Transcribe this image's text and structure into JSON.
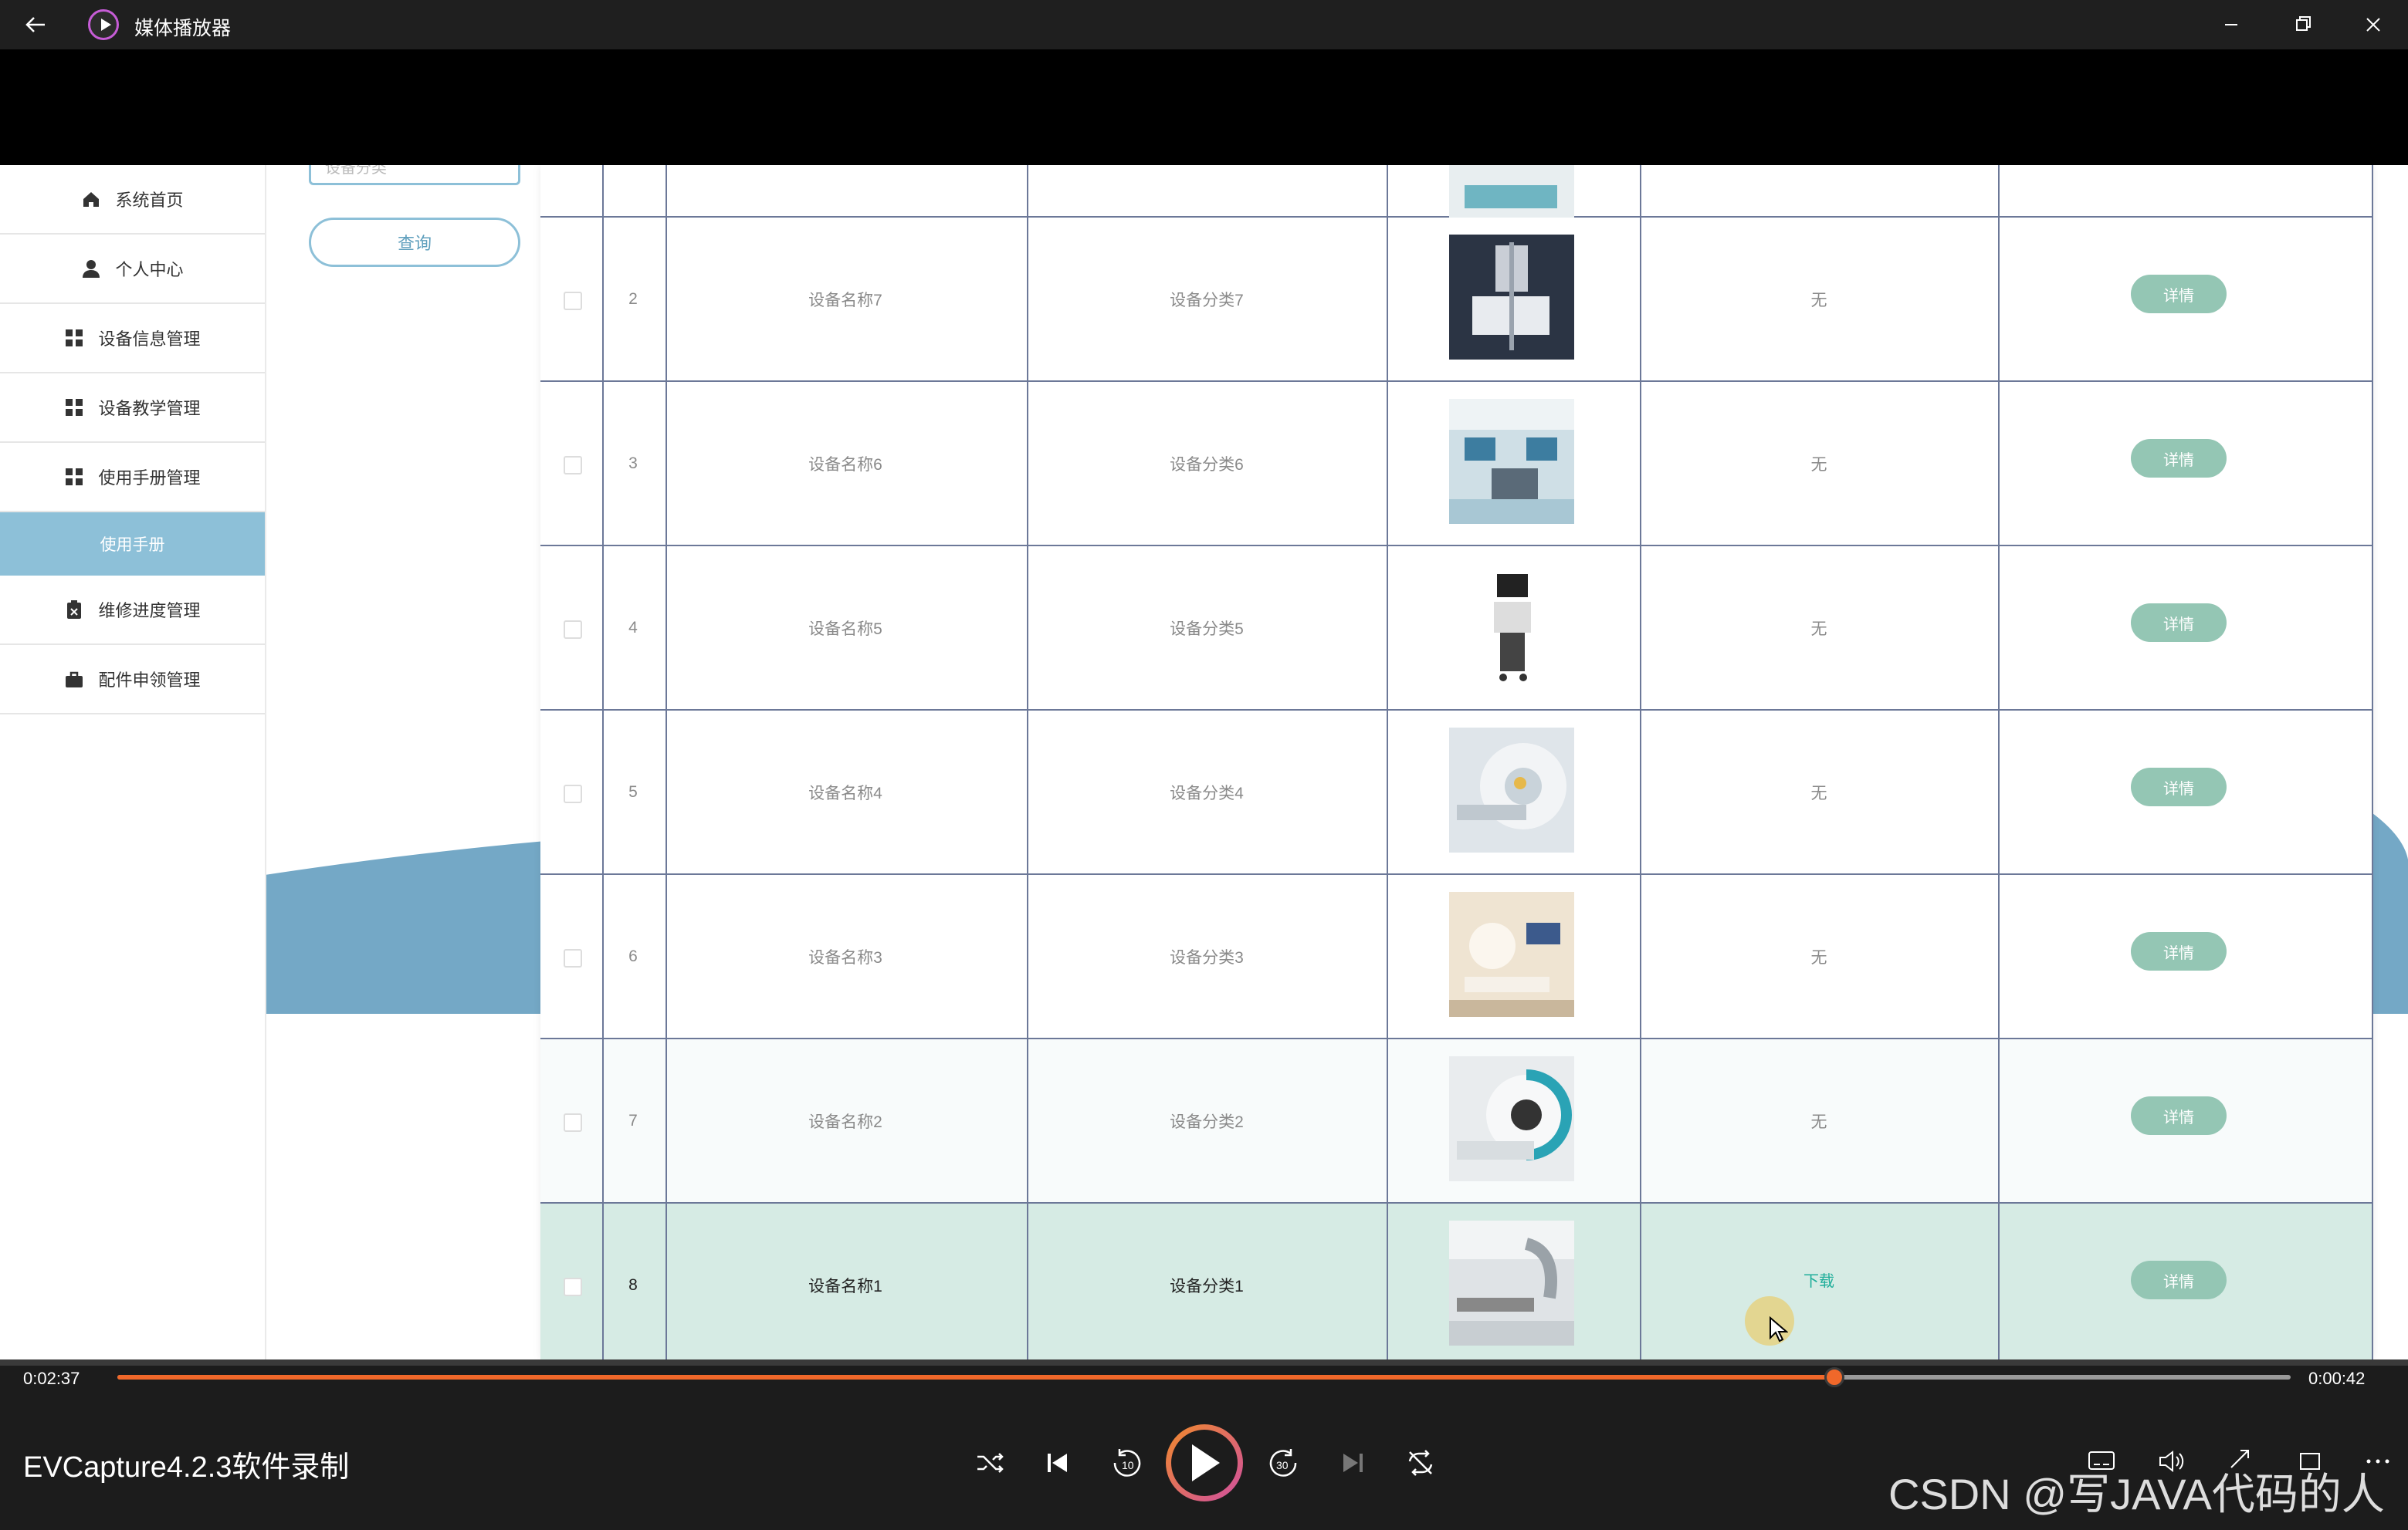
{
  "window": {
    "title": "媒体播放器"
  },
  "sidebar": {
    "items": [
      {
        "label": "系统首页",
        "icon": "home-icon"
      },
      {
        "label": "个人中心",
        "icon": "user-icon"
      },
      {
        "label": "设备信息管理",
        "icon": "grid-icon"
      },
      {
        "label": "设备教学管理",
        "icon": "grid-icon"
      },
      {
        "label": "使用手册管理",
        "icon": "grid-icon"
      },
      {
        "label": "维修进度管理",
        "icon": "clipboard-icon"
      },
      {
        "label": "配件申领管理",
        "icon": "briefcase-icon"
      }
    ],
    "active_sub": "使用手册"
  },
  "search": {
    "placeholder": "设备分类",
    "query_label": "查询"
  },
  "table": {
    "rows": [
      {
        "index": "2",
        "name": "设备名称7",
        "category": "设备分类7",
        "file": "无",
        "action": "详情"
      },
      {
        "index": "3",
        "name": "设备名称6",
        "category": "设备分类6",
        "file": "无",
        "action": "详情"
      },
      {
        "index": "4",
        "name": "设备名称5",
        "category": "设备分类5",
        "file": "无",
        "action": "详情"
      },
      {
        "index": "5",
        "name": "设备名称4",
        "category": "设备分类4",
        "file": "无",
        "action": "详情"
      },
      {
        "index": "6",
        "name": "设备名称3",
        "category": "设备分类3",
        "file": "无",
        "action": "详情"
      },
      {
        "index": "7",
        "name": "设备名称2",
        "category": "设备分类2",
        "file": "无",
        "action": "详情"
      },
      {
        "index": "8",
        "name": "设备名称1",
        "category": "设备分类1",
        "file": "下载",
        "action": "详情"
      }
    ]
  },
  "player": {
    "elapsed": "0:02:37",
    "remaining": "0:00:42",
    "progress_fraction": 0.79,
    "title": "EVCapture4.2.3软件录制",
    "watermark": "CSDN @写JAVA代码的人",
    "accent_color": "#f0682a"
  }
}
